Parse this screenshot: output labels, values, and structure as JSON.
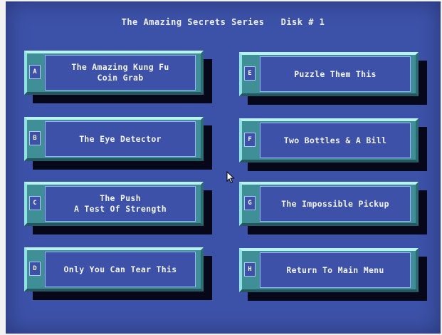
{
  "title": "The Amazing Secrets Series   Disk # 1",
  "buttons": [
    {
      "key": "A",
      "label": "The Amazing Kung Fu\nCoin Grab"
    },
    {
      "key": "B",
      "label": "The Eye Detector"
    },
    {
      "key": "C",
      "label": "The Push\nA Test Of Strength"
    },
    {
      "key": "D",
      "label": "Only You Can Tear This"
    },
    {
      "key": "E",
      "label": "Puzzle Them This"
    },
    {
      "key": "F",
      "label": "Two Bottles & A Bill"
    },
    {
      "key": "G",
      "label": "The Impossible Pickup"
    },
    {
      "key": "H",
      "label": "Return To Main Menu"
    }
  ],
  "colors": {
    "background": "#3c52a8",
    "frame": "#3f8f96",
    "frame_highlight": "#b9f3ef",
    "text": "#f2f4ff"
  },
  "cursor": {
    "icon": "mouse-pointer-icon"
  }
}
